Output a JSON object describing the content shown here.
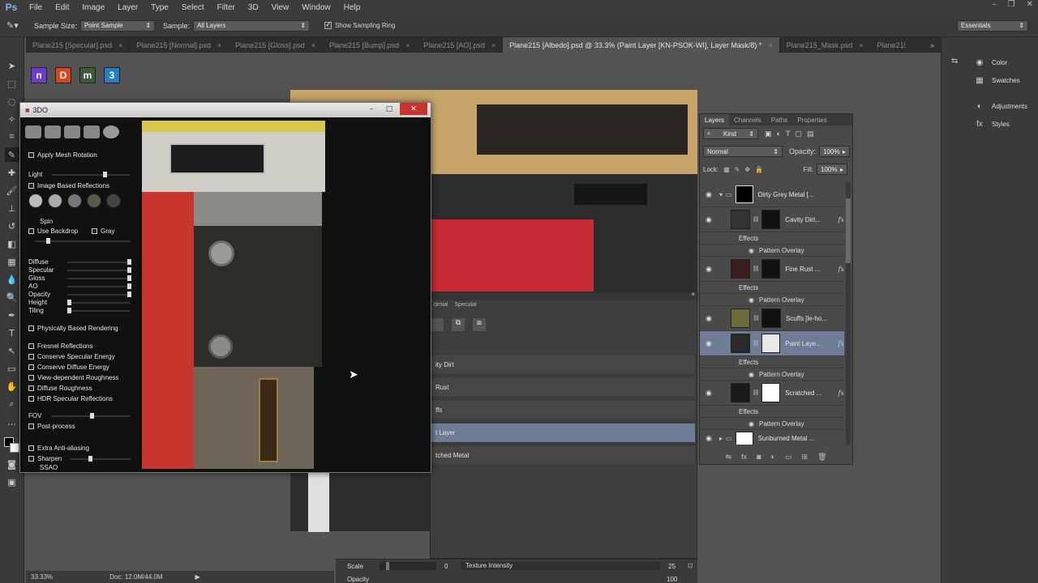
{
  "app": {
    "logo": "Ps"
  },
  "menu": [
    "File",
    "Edit",
    "Image",
    "Layer",
    "Type",
    "Select",
    "Filter",
    "3D",
    "View",
    "Window",
    "Help"
  ],
  "options": {
    "sample_size_label": "Sample Size:",
    "sample_size_value": "Point Sample",
    "sample_label": "Sample:",
    "sample_value": "All Layers",
    "show_ring_label": "Show Sampling Ring",
    "workspace": "Essentials"
  },
  "tabs": [
    {
      "label": "Plane215 [Specular].psd"
    },
    {
      "label": "Plane215 [Normal].psd"
    },
    {
      "label": "Plane215 [Gloss].psd"
    },
    {
      "label": "Plane215 [Bump].psd"
    },
    {
      "label": "Plane215 [AO].psd"
    },
    {
      "label": "Plane215 [Albedo].psd @ 33.3% (Paint Layer [KN-PSOK-WI], Layer Mask/8) *"
    },
    {
      "label": "Plane215_Mask.psd"
    },
    {
      "label": "Plane21!"
    }
  ],
  "launchers": [
    "n",
    "D",
    "m",
    "3"
  ],
  "status": {
    "zoom": "33.33%",
    "doc": "Doc: 12.0M/44.0M"
  },
  "win3do": {
    "title": "3DO",
    "controls": {
      "apply_mesh_rotation": "Apply Mesh Rotation",
      "light": "Light",
      "ibr": "Image Based Reflections",
      "spin": "Spin",
      "use_backdrop": "Use Backdrop",
      "gray": "Gray",
      "diffuse": "Diffuse",
      "specular": "Specular",
      "gloss": "Gloss",
      "ao": "AO",
      "opacity": "Opacity",
      "height": "Height",
      "tiling": "Tiling",
      "pbr": "Physically Based Rendering",
      "fresnel": "Fresnel Reflections",
      "conserve_spec": "Conserve Specular Energy",
      "conserve_diff": "Conserve Diffuse Energy",
      "view_rough": "View-dependent Roughness",
      "diff_rough": "Diffuse Roughness",
      "hdr_spec": "HDR Specular Reflections",
      "fov": "FOV",
      "post_process": "Post-process",
      "extra_aa": "Extra Anti-aliasing",
      "sharpen": "Sharpen",
      "ssao": "SSAO"
    }
  },
  "subpanel": {
    "tabs": [
      "ormal",
      "Specular"
    ],
    "items": [
      "ity Dirt",
      "Rust",
      "ffs",
      "t Layer",
      "tched Metal"
    ]
  },
  "properties": {
    "scale_label": "Scale",
    "scale_value": "0",
    "texture_intensity_label": "Texture Intensity",
    "texture_intensity_value": "25",
    "opacity_label": "Opacity",
    "opacity_value": "100"
  },
  "layers_panel": {
    "tabs": [
      "Layers",
      "Channels",
      "Paths",
      "Properties"
    ],
    "kind_label": "Kind",
    "blend_mode": "Normal",
    "opacity_label": "Opacity:",
    "opacity_value": "100%",
    "lock_label": "Lock:",
    "fill_label": "Fill:",
    "fill_value": "100%",
    "group_name": "Dirty Grey Metal [...",
    "layers": [
      {
        "name": "Cavity Dirt...",
        "effects": "Effects",
        "overlay": "Pattern Overlay"
      },
      {
        "name": "Fine Rust ...",
        "effects": "Effects",
        "overlay": "Pattern Overlay"
      },
      {
        "name": "Scuffs [le-ho...",
        "effects": "",
        "overlay": ""
      },
      {
        "name": "Paint Laye...",
        "effects": "Effects",
        "overlay": "Pattern Overlay"
      },
      {
        "name": "Scratched ...",
        "effects": "Effects",
        "overlay": "Pattern Overlay"
      }
    ],
    "group2_name": "Sunburned Metal ...",
    "fx_label": "fx"
  },
  "right_dock": [
    "Color",
    "Swatches",
    "Adjustments",
    "Styles"
  ]
}
